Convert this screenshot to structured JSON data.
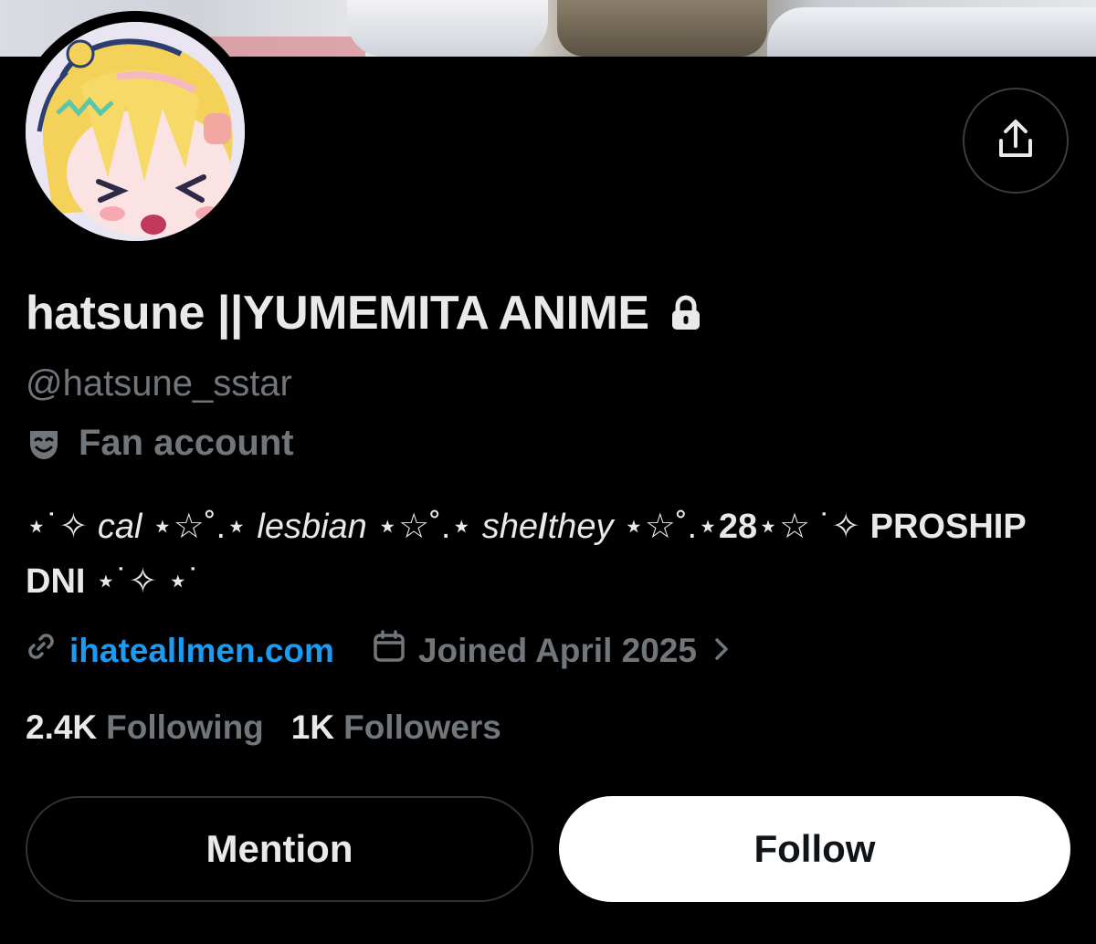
{
  "profile": {
    "display_name": "hatsune ||YUMEMITA ANIME",
    "handle": "@hatsune_sstar",
    "category": "Fan account",
    "bio": {
      "p1": "⋆˙✧ ",
      "p2": "cal",
      "p3": " ⋆☆˚.⋆ ",
      "p4": "lesbian",
      "p5": " ⋆☆˚.⋆ ",
      "p6": "she",
      "p7": "/",
      "p8": "they",
      "p9": " ⋆☆˚.⋆",
      "p10": "28",
      "p11": "⋆☆ ˙✧ ",
      "p12": "PROSHIP DNI",
      "p13": " ⋆˙✧ ⋆˙"
    },
    "website": "ihateallmen.com",
    "joined": "Joined April 2025",
    "following_count": "2.4K",
    "following_label": "Following",
    "followers_count": "1K",
    "followers_label": "Followers"
  },
  "actions": {
    "mention_label": "Mention",
    "follow_label": "Follow"
  },
  "icons": {
    "share": "share-icon",
    "lock": "lock-icon",
    "category": "theater-mask-icon",
    "link": "link-icon",
    "calendar": "calendar-icon",
    "chevron": "chevron-right-icon"
  },
  "colors": {
    "background": "#000000",
    "text": "#e7e9ea",
    "muted": "#71767b",
    "link": "#1d9bf0",
    "follow_bg": "#ffffff"
  }
}
